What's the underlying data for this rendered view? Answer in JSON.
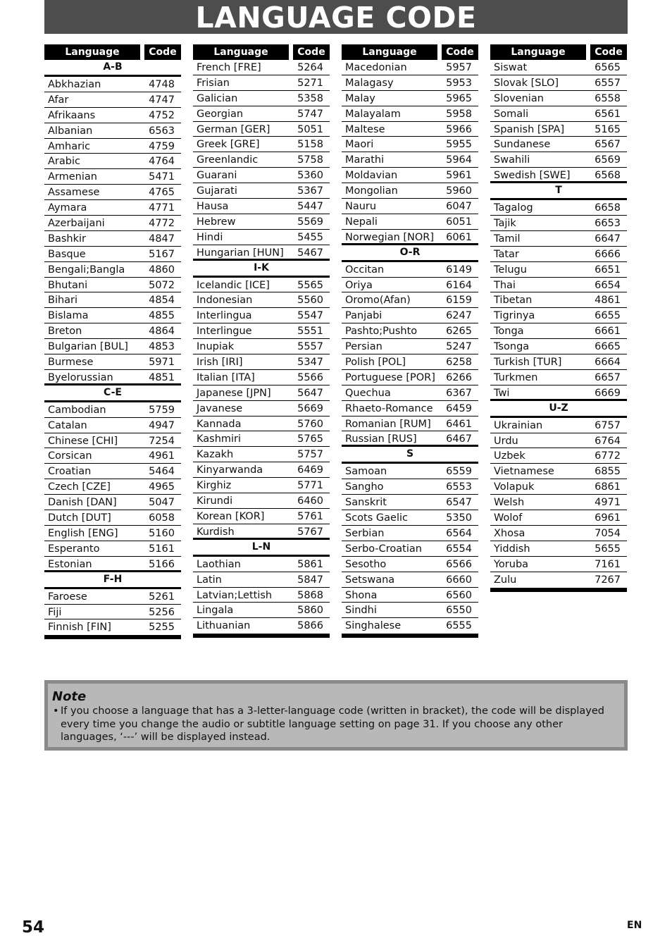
{
  "page": {
    "title": "LANGUAGE CODE",
    "page_number": "54",
    "language_tag": "EN"
  },
  "table_headers": {
    "language": "Language",
    "code": "Code"
  },
  "columns": [
    {
      "blocks": [
        {
          "section": "A-B",
          "rows": [
            [
              "Abkhazian",
              "4748"
            ],
            [
              "Afar",
              "4747"
            ],
            [
              "Afrikaans",
              "4752"
            ],
            [
              "Albanian",
              "6563"
            ],
            [
              "Amharic",
              "4759"
            ],
            [
              "Arabic",
              "4764"
            ],
            [
              "Armenian",
              "5471"
            ],
            [
              "Assamese",
              "4765"
            ],
            [
              "Aymara",
              "4771"
            ],
            [
              "Azerbaijani",
              "4772"
            ],
            [
              "Bashkir",
              "4847"
            ],
            [
              "Basque",
              "5167"
            ],
            [
              "Bengali;Bangla",
              "4860"
            ],
            [
              "Bhutani",
              "5072"
            ],
            [
              "Bihari",
              "4854"
            ],
            [
              "Bislama",
              "4855"
            ],
            [
              "Breton",
              "4864"
            ],
            [
              "Bulgarian [BUL]",
              "4853"
            ],
            [
              "Burmese",
              "5971"
            ],
            [
              "Byelorussian",
              "4851"
            ]
          ]
        },
        {
          "section": "C-E",
          "rows": [
            [
              "Cambodian",
              "5759"
            ],
            [
              "Catalan",
              "4947"
            ],
            [
              "Chinese [CHI]",
              "7254"
            ],
            [
              "Corsican",
              "4961"
            ],
            [
              "Croatian",
              "5464"
            ],
            [
              "Czech [CZE]",
              "4965"
            ],
            [
              "Danish [DAN]",
              "5047"
            ],
            [
              "Dutch [DUT]",
              "6058"
            ],
            [
              "English [ENG]",
              "5160"
            ],
            [
              "Esperanto",
              "5161"
            ],
            [
              "Estonian",
              "5166"
            ]
          ]
        },
        {
          "section": "F-H",
          "rows": [
            [
              "Faroese",
              "5261"
            ],
            [
              "Fiji",
              "5256"
            ],
            [
              "Finnish [FIN]",
              "5255"
            ]
          ]
        }
      ]
    },
    {
      "blocks": [
        {
          "section": "",
          "rows": [
            [
              "French [FRE]",
              "5264"
            ],
            [
              "Frisian",
              "5271"
            ],
            [
              "Galician",
              "5358"
            ],
            [
              "Georgian",
              "5747"
            ],
            [
              "German [GER]",
              "5051"
            ],
            [
              "Greek [GRE]",
              "5158"
            ],
            [
              "Greenlandic",
              "5758"
            ],
            [
              "Guarani",
              "5360"
            ],
            [
              "Gujarati",
              "5367"
            ],
            [
              "Hausa",
              "5447"
            ],
            [
              "Hebrew",
              "5569"
            ],
            [
              "Hindi",
              "5455"
            ],
            [
              "Hungarian [HUN]",
              "5467"
            ]
          ]
        },
        {
          "section": "I-K",
          "rows": [
            [
              "Icelandic [ICE]",
              "5565"
            ],
            [
              "Indonesian",
              "5560"
            ],
            [
              "Interlingua",
              "5547"
            ],
            [
              "Interlingue",
              "5551"
            ],
            [
              "Inupiak",
              "5557"
            ],
            [
              "Irish [IRI]",
              "5347"
            ],
            [
              "Italian [ITA]",
              "5566"
            ],
            [
              "Japanese [JPN]",
              "5647"
            ],
            [
              "Javanese",
              "5669"
            ],
            [
              "Kannada",
              "5760"
            ],
            [
              "Kashmiri",
              "5765"
            ],
            [
              "Kazakh",
              "5757"
            ],
            [
              "Kinyarwanda",
              "6469"
            ],
            [
              "Kirghiz",
              "5771"
            ],
            [
              "Kirundi",
              "6460"
            ],
            [
              "Korean [KOR]",
              "5761"
            ],
            [
              "Kurdish",
              "5767"
            ]
          ]
        },
        {
          "section": "L-N",
          "rows": [
            [
              "Laothian",
              "5861"
            ],
            [
              "Latin",
              "5847"
            ],
            [
              "Latvian;Lettish",
              "5868"
            ],
            [
              "Lingala",
              "5860"
            ],
            [
              "Lithuanian",
              "5866"
            ]
          ]
        }
      ]
    },
    {
      "blocks": [
        {
          "section": "",
          "rows": [
            [
              "Macedonian",
              "5957"
            ],
            [
              "Malagasy",
              "5953"
            ],
            [
              "Malay",
              "5965"
            ],
            [
              "Malayalam",
              "5958"
            ],
            [
              "Maltese",
              "5966"
            ],
            [
              "Maori",
              "5955"
            ],
            [
              "Marathi",
              "5964"
            ],
            [
              "Moldavian",
              "5961"
            ],
            [
              "Mongolian",
              "5960"
            ],
            [
              "Nauru",
              "6047"
            ],
            [
              "Nepali",
              "6051"
            ],
            [
              "Norwegian [NOR]",
              "6061"
            ]
          ]
        },
        {
          "section": "O-R",
          "rows": [
            [
              "Occitan",
              "6149"
            ],
            [
              "Oriya",
              "6164"
            ],
            [
              "Oromo(Afan)",
              "6159"
            ],
            [
              "Panjabi",
              "6247"
            ],
            [
              "Pashto;Pushto",
              "6265"
            ],
            [
              "Persian",
              "5247"
            ],
            [
              "Polish [POL]",
              "6258"
            ],
            [
              "Portuguese [POR]",
              "6266"
            ],
            [
              "Quechua",
              "6367"
            ],
            [
              "Rhaeto-Romance",
              "6459"
            ],
            [
              "Romanian [RUM]",
              "6461"
            ],
            [
              "Russian [RUS]",
              "6467"
            ]
          ]
        },
        {
          "section": "S",
          "rows": [
            [
              "Samoan",
              "6559"
            ],
            [
              "Sangho",
              "6553"
            ],
            [
              "Sanskrit",
              "6547"
            ],
            [
              "Scots Gaelic",
              "5350"
            ],
            [
              "Serbian",
              "6564"
            ],
            [
              "Serbo-Croatian",
              "6554"
            ],
            [
              "Sesotho",
              "6566"
            ],
            [
              "Setswana",
              "6660"
            ],
            [
              "Shona",
              "6560"
            ],
            [
              "Sindhi",
              "6550"
            ],
            [
              "Singhalese",
              "6555"
            ]
          ]
        }
      ]
    },
    {
      "blocks": [
        {
          "section": "",
          "rows": [
            [
              "Siswat",
              "6565"
            ],
            [
              "Slovak [SLO]",
              "6557"
            ],
            [
              "Slovenian",
              "6558"
            ],
            [
              "Somali",
              "6561"
            ],
            [
              "Spanish [SPA]",
              "5165"
            ],
            [
              "Sundanese",
              "6567"
            ],
            [
              "Swahili",
              "6569"
            ],
            [
              "Swedish [SWE]",
              "6568"
            ]
          ]
        },
        {
          "section": "T",
          "rows": [
            [
              "Tagalog",
              "6658"
            ],
            [
              "Tajik",
              "6653"
            ],
            [
              "Tamil",
              "6647"
            ],
            [
              "Tatar",
              "6666"
            ],
            [
              "Telugu",
              "6651"
            ],
            [
              "Thai",
              "6654"
            ],
            [
              "Tibetan",
              "4861"
            ],
            [
              "Tigrinya",
              "6655"
            ],
            [
              "Tonga",
              "6661"
            ],
            [
              "Tsonga",
              "6665"
            ],
            [
              "Turkish [TUR]",
              "6664"
            ],
            [
              "Turkmen",
              "6657"
            ],
            [
              "Twi",
              "6669"
            ]
          ]
        },
        {
          "section": "U-Z",
          "rows": [
            [
              "Ukrainian",
              "6757"
            ],
            [
              "Urdu",
              "6764"
            ],
            [
              "Uzbek",
              "6772"
            ],
            [
              "Vietnamese",
              "6855"
            ],
            [
              "Volapuk",
              "6861"
            ],
            [
              "Welsh",
              "4971"
            ],
            [
              "Wolof",
              "6961"
            ],
            [
              "Xhosa",
              "7054"
            ],
            [
              "Yiddish",
              "5655"
            ],
            [
              "Yoruba",
              "7161"
            ],
            [
              "Zulu",
              "7267"
            ]
          ]
        }
      ]
    }
  ],
  "note": {
    "title": "Note",
    "bullet": "•",
    "text": "If you choose a language that has a 3-letter-language code (written in bracket), the code will be displayed every time you change the audio or subtitle language setting on page 31. If you choose any other languages, ‘---’ will be displayed instead."
  }
}
